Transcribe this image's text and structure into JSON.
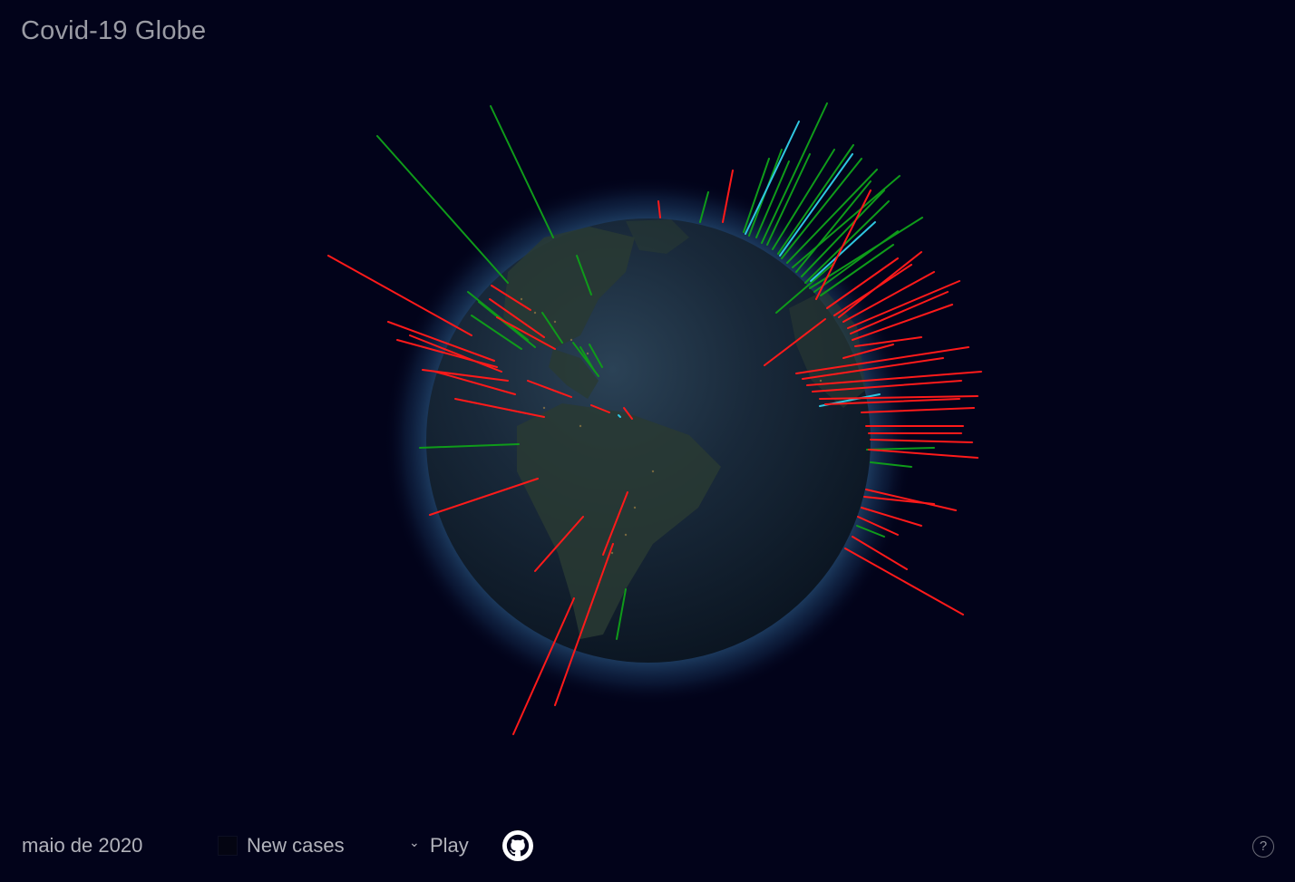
{
  "app": {
    "title": "Covid-19 Globe"
  },
  "controls": {
    "date_label": "maio de 2020",
    "metric_selected": "New cases",
    "chevron": "⌄",
    "play_label": "Play",
    "github_icon": "github-icon",
    "help_label": "?"
  },
  "colors": {
    "background": "#02031a",
    "bar_red": "#ff1a1a",
    "bar_green": "#0f9b1a",
    "bar_cyan": "#2fc6e0"
  },
  "globe": {
    "view": "Americas facing viewer"
  }
}
